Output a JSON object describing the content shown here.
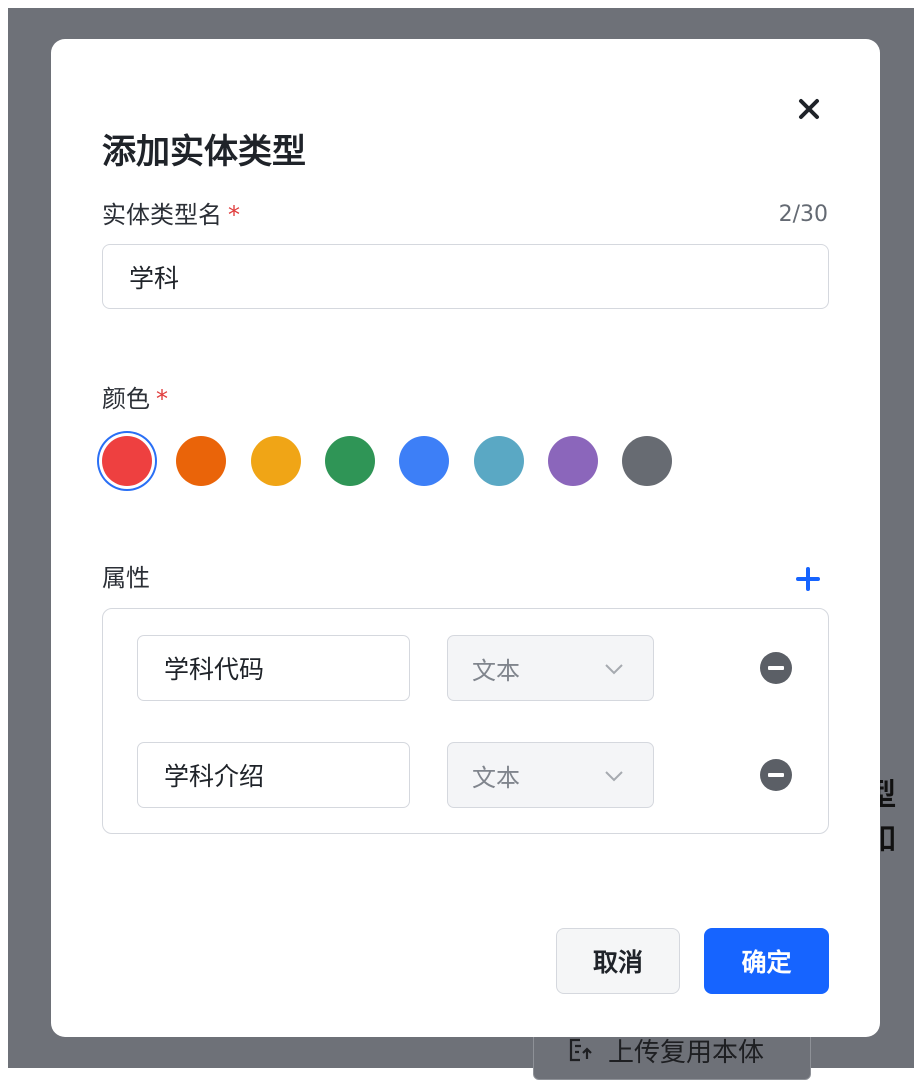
{
  "background": {
    "partial_text": "型吅",
    "upload_button_label": "上传复用本体",
    "upload_icon": "upload-file-icon"
  },
  "dialog": {
    "title": "添加实体类型",
    "close_icon": "close-icon",
    "name_field": {
      "label": "实体类型名",
      "required_mark": "*",
      "counter": "2/30",
      "value": "学科"
    },
    "color_field": {
      "label": "颜色",
      "required_mark": "*",
      "options": [
        "#ee4040",
        "#ea6409",
        "#f0a516",
        "#2f9556",
        "#3d7ff7",
        "#5aa8c4",
        "#8b66bb",
        "#676b72"
      ],
      "selected_index": 0
    },
    "attributes": {
      "label": "属性",
      "add_icon": "plus-icon",
      "items": [
        {
          "name": "学科代码",
          "type": "文本"
        },
        {
          "name": "学科介绍",
          "type": "文本"
        }
      ]
    },
    "buttons": {
      "cancel": "取消",
      "confirm": "确定"
    },
    "accent_color": "#1664ff"
  }
}
